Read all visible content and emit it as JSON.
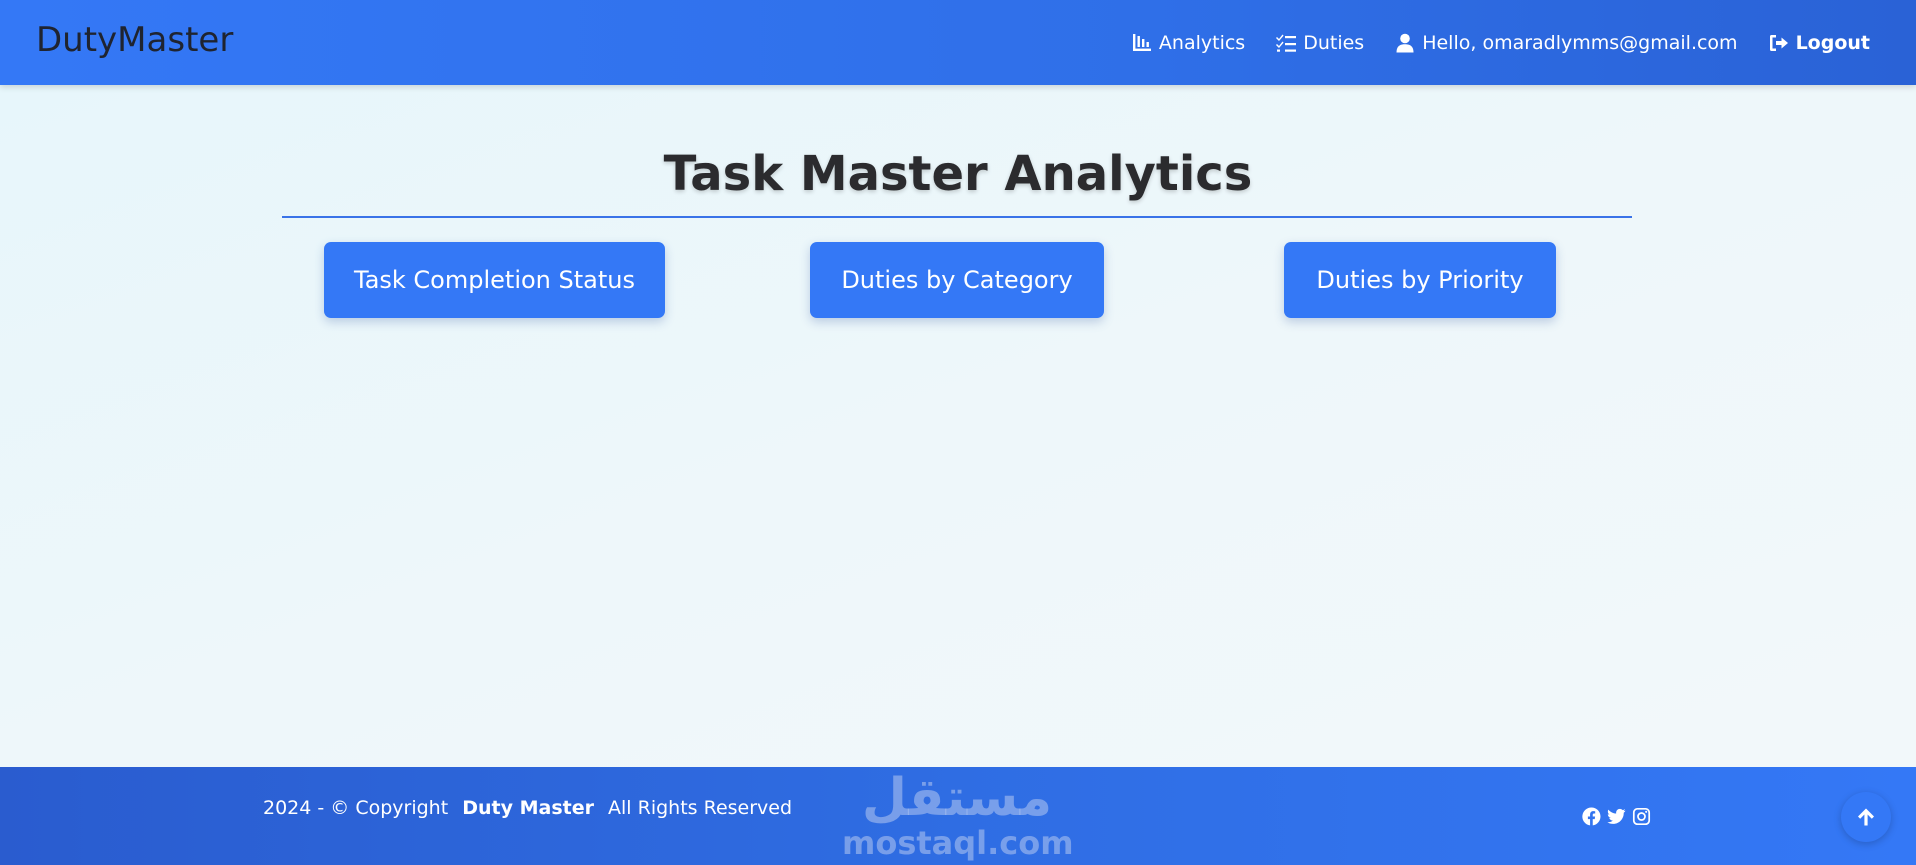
{
  "navbar": {
    "brand": "DutyMaster",
    "links": {
      "analytics": "Analytics",
      "duties": "Duties",
      "user": "Hello, omaradlymms@gmail.com",
      "logout": "Logout"
    }
  },
  "main": {
    "title": "Task Master Analytics",
    "buttons": {
      "completion": "Task Completion Status",
      "category": "Duties by Category",
      "priority": "Duties by Priority"
    }
  },
  "footer": {
    "copyright_prefix": "2024 - © Copyright",
    "copyright_brand": "Duty Master",
    "copyright_suffix": "All Rights Reserved",
    "watermark_ar": "مستقل",
    "watermark_en": "mostaql.com"
  },
  "icons": {
    "analytics": "chart-line-icon",
    "duties": "list-check-icon",
    "user": "user-icon",
    "logout": "sign-out-icon",
    "facebook": "facebook-icon",
    "twitter": "twitter-icon",
    "instagram": "instagram-icon",
    "back_to_top": "arrow-up-icon"
  },
  "colors": {
    "primary": "#3478f6",
    "footer": "#2f6de3",
    "title": "#2b2b2e"
  }
}
